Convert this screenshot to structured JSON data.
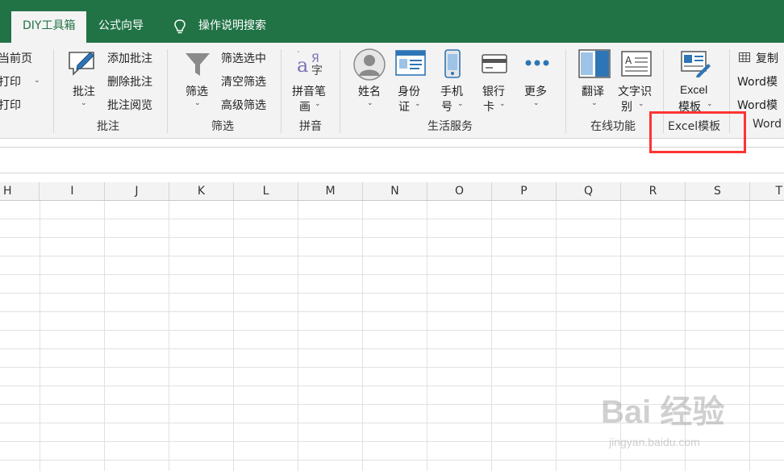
{
  "tabs": {
    "active": "DIY工具箱",
    "formula_wizard": "公式向导",
    "search": "操作说明搜索"
  },
  "ribbon": {
    "print": {
      "current_page": "当前页",
      "print_a": "打印",
      "print_b": "打印"
    },
    "comments": {
      "button": "批注",
      "add": "添加批注",
      "delete": "删除批注",
      "read": "批注阅览",
      "group": "批注"
    },
    "filter": {
      "button": "筛选",
      "filter_selected": "筛选选中",
      "clear": "清空筛选",
      "advanced": "高级筛选",
      "group": "筛选"
    },
    "pinyin": {
      "line1": "拼音笔",
      "line2": "画",
      "group": "拼音"
    },
    "life": {
      "name": "姓名",
      "id_line1": "身份",
      "id_line2": "证",
      "phone_line1": "手机",
      "phone_line2": "号",
      "bank_line1": "银行",
      "bank_line2": "卡",
      "more": "更多",
      "group": "生活服务"
    },
    "online": {
      "translate": "翻译",
      "ocr_line1": "文字识",
      "ocr_line2": "别",
      "group": "在线功能"
    },
    "excel_template": {
      "line1": "Excel",
      "line2": "模板",
      "group": "Excel模板"
    },
    "word": {
      "copy": "复制",
      "word_a": "Word模",
      "word_b": "Word模",
      "group": "Word"
    }
  },
  "columns": [
    "H",
    "I",
    "J",
    "K",
    "L",
    "M",
    "N",
    "O",
    "P",
    "Q",
    "R",
    "S",
    "T"
  ],
  "watermark": {
    "line1": "Bai 经验",
    "line2": "jingyan.baidu.com"
  }
}
